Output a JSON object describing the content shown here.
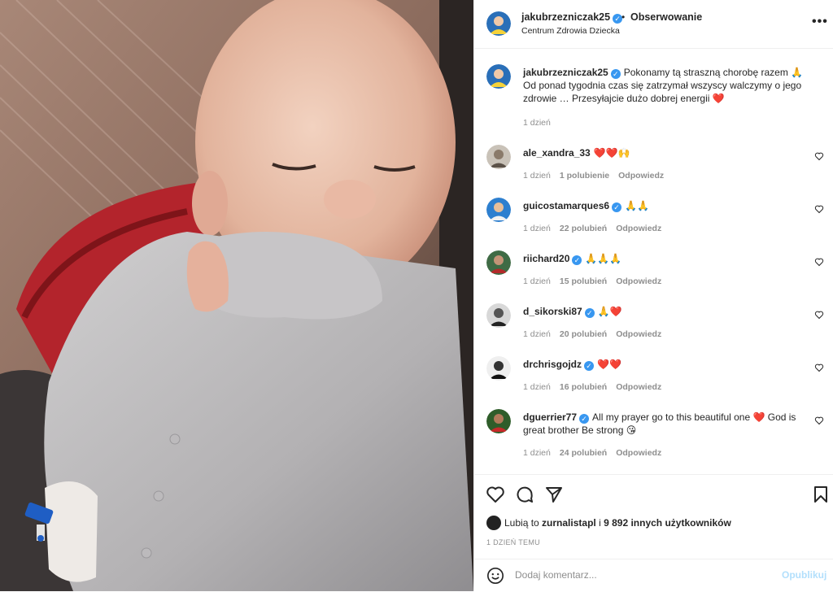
{
  "header": {
    "username": "jakubrzezniczak25",
    "dot": "•",
    "follow_label": "Obserwowanie",
    "location": "Centrum Zdrowia Dziecka",
    "more_icon": "more-horizontal-icon",
    "more_label": "•••"
  },
  "caption": {
    "username": "jakubrzezniczak25",
    "text": "Pokonamy tą straszną chorobę razem 🙏 Od ponad tygodnia czas się zatrzymał wszyscy walczymy o jego zdrowie … Przesyłajcie dużo dobrej energii ❤️",
    "time": "1 dzień"
  },
  "comments": [
    {
      "username": "ale_xandra_33",
      "verified": false,
      "text": "❤️❤️🙌",
      "time": "1 dzień",
      "likes": "1 polubienie",
      "reply": "Odpowiedz"
    },
    {
      "username": "guicostamarques6",
      "verified": true,
      "text": "🙏🙏",
      "time": "1 dzień",
      "likes": "22 polubień",
      "reply": "Odpowiedz"
    },
    {
      "username": "riichard20",
      "verified": true,
      "text": "🙏🙏🙏",
      "time": "1 dzień",
      "likes": "15 polubień",
      "reply": "Odpowiedz"
    },
    {
      "username": "d_sikorski87",
      "verified": true,
      "text": "🙏❤️",
      "time": "1 dzień",
      "likes": "20 polubień",
      "reply": "Odpowiedz"
    },
    {
      "username": "drchrisgojdz",
      "verified": true,
      "text": "❤️❤️",
      "time": "1 dzień",
      "likes": "16 polubień",
      "reply": "Odpowiedz"
    },
    {
      "username": "dguerrier77",
      "verified": true,
      "text": "All my prayer go to this beautiful one ❤️ God is great brother Be strong 😘",
      "time": "1 dzień",
      "likes": "24 polubień",
      "reply": "Odpowiedz"
    }
  ],
  "likes": {
    "prefix": "Lubią to",
    "user": "zurnalistapl",
    "middle": "i",
    "others": "9 892 innych użytkowników"
  },
  "date": "1 DZIEŃ TEMU",
  "comment_box": {
    "placeholder": "Dodaj komentarz...",
    "publish": "Opublikuj"
  },
  "colors": {
    "verified": "#3897f0",
    "heart": "#ed4956",
    "muted": "#8e8e8e",
    "publish_disabled": "#b2dffc"
  }
}
